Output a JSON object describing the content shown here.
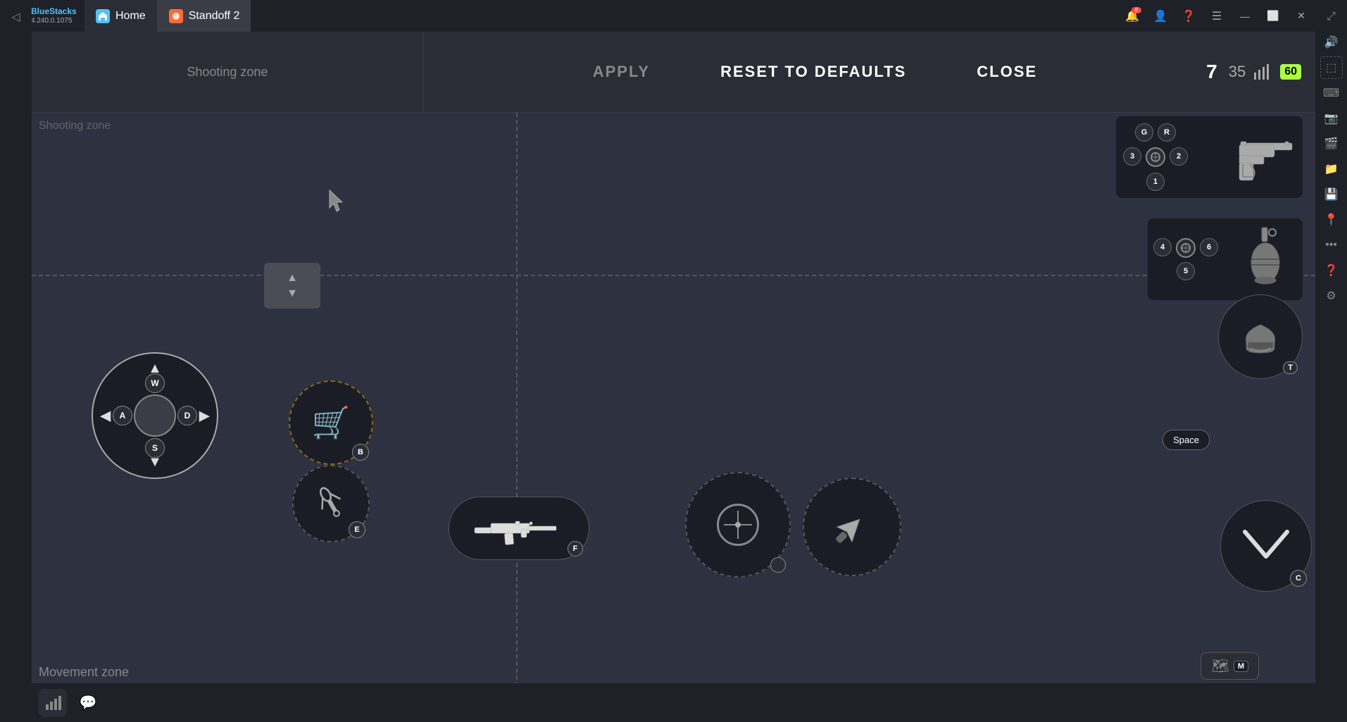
{
  "titlebar": {
    "app_name": "BlueStacks",
    "app_version": "4.240.0.1075",
    "home_tab": "Home",
    "game_tab": "Standoff 2",
    "notif_badge": "8"
  },
  "toolbar": {
    "shooting_zone_label": "Shooting zone",
    "apply_label": "APPLY",
    "reset_label": "RESET TO DEFAULTS",
    "close_label": "CLOSE"
  },
  "hud": {
    "ammo_current": "7",
    "ammo_total": "35",
    "fps": "60"
  },
  "controls": {
    "move_up": "W",
    "move_left": "A",
    "move_down": "S",
    "move_right": "D",
    "shop": "B",
    "equip": "E",
    "fire": "F",
    "aim": "",
    "knife": "",
    "helmet": "T",
    "crouch": "C",
    "jump": "Space",
    "map": "M",
    "pistol_r": "R",
    "pistol_g": "G",
    "pistol_1": "1",
    "pistol_2": "2",
    "pistol_3": "3",
    "grenade_4": "4",
    "grenade_5": "5",
    "grenade_6": "6"
  },
  "zones": {
    "movement_label": "Movement zone"
  },
  "sidebar": {
    "icons": [
      "🔊",
      "⬚",
      "⌨",
      "📷",
      "🎬",
      "📁",
      "💾",
      "📍",
      "…",
      "❓",
      "⚙"
    ]
  }
}
